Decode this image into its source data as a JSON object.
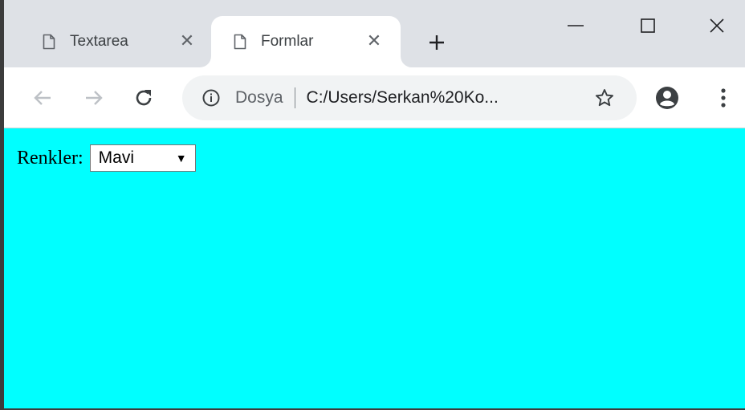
{
  "tabs": [
    {
      "title": "Textarea",
      "icon": "document-icon",
      "close": "✕"
    },
    {
      "title": "Formlar",
      "icon": "document-icon",
      "close": "✕"
    }
  ],
  "toolbar": {
    "scheme": "Dosya",
    "url": "C:/Users/Serkan%20Ko..."
  },
  "page": {
    "background": "#00ffff",
    "label": "Renkler:",
    "select_value": "Mavi"
  }
}
